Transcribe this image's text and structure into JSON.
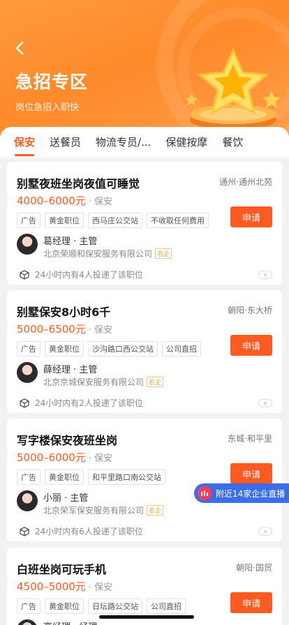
{
  "header": {
    "title": "急招专区",
    "subtitle": "岗位急招入职快"
  },
  "tabs": [
    {
      "label": "保安",
      "active": true
    },
    {
      "label": "送餐员",
      "active": false
    },
    {
      "label": "物流专员/...",
      "active": false
    },
    {
      "label": "保健按摩",
      "active": false
    },
    {
      "label": "餐饮",
      "active": false
    }
  ],
  "jobs": [
    {
      "title": "别墅夜班坐岗夜值可睡觉",
      "location": "通州·通州北苑",
      "salary": "4000–6000元",
      "category": "· 保安",
      "tags": [
        "广告",
        "黄金职位",
        "西马庄公交站",
        "不收取任何费用"
      ],
      "apply": "申请",
      "recruiter": "葛经理 · 主管",
      "company": "北京荣顺和保安服务有限公司",
      "badge": "名企",
      "stats": "24小时内有4人投递了该职位"
    },
    {
      "title": "别墅保安8小时6千",
      "location": "朝阳·东大桥",
      "salary": "5000–6500元",
      "category": "· 保安",
      "tags": [
        "广告",
        "黄金职位",
        "沙沟路口西公交站",
        "公司直招"
      ],
      "apply": "申请",
      "recruiter": "薛经理 · 主管",
      "company": "北京京城保安服务有限公司",
      "badge": "名企",
      "stats": "24小时内有2人投递了该职位"
    },
    {
      "title": "写字楼保安夜班坐岗",
      "location": "东城·和平里",
      "salary": "5000–6000元",
      "category": "· 保安",
      "tags": [
        "广告",
        "黄金职位",
        "和平里路口南公交站"
      ],
      "apply": "申请",
      "recruiter": "小丽 · 主管",
      "company": "北京荣军保安服务有限公司",
      "badge": "名企",
      "stats": "24小时内有6人投递了该职位"
    },
    {
      "title": "白班坐岗可玩手机",
      "location": "朝阳·国贸",
      "salary": "4500–5000元",
      "category": "· 保安",
      "tags": [
        "广告",
        "黄金职位",
        "日坛路公交站",
        "公司直招"
      ],
      "apply": "申请",
      "recruiter": "高经理 · 经理"
    }
  ],
  "float": {
    "label": "附近14家企业直播"
  },
  "colors": {
    "accent": "#ff5a1f",
    "hero_start": "#ff9a3c",
    "live_blue": "#3a6de6"
  }
}
